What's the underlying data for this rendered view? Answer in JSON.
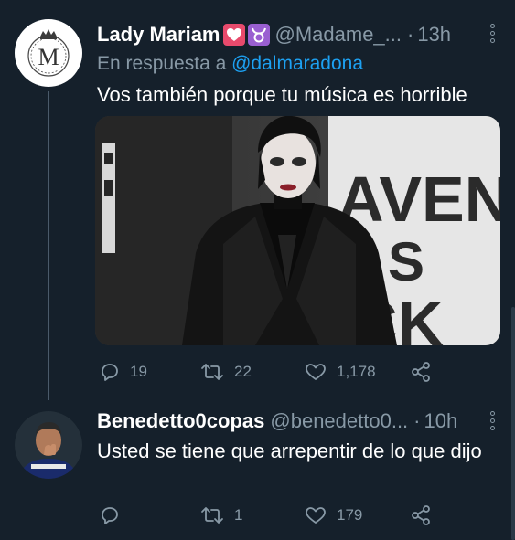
{
  "tweets": [
    {
      "name": "Lady Mariam",
      "handle": "@Madame_...",
      "time": "13h",
      "reply_prefix": "En respuesta a",
      "reply_mention": "@dalmaradona",
      "text": "Vos también porque tu música es horrible",
      "avatar_letter": "M",
      "emojis": [
        "heart-emoji",
        "taurus-emoji"
      ],
      "stats": {
        "replies": "19",
        "retweets": "22",
        "likes": "1,178"
      }
    },
    {
      "name": "Benedetto0copas",
      "handle": "@benedetto0...",
      "time": "10h",
      "text": "Usted se tiene que arrepentir de lo que dijo",
      "stats": {
        "replies": "",
        "retweets": "1",
        "likes": "179"
      }
    }
  ],
  "media": {
    "backdrop_text": "AVEN",
    "backdrop_text2": "S",
    "backdrop_text3": "CK"
  },
  "colors": {
    "background": "#15202b",
    "text_secondary": "#8899a6",
    "link": "#1da1f2"
  },
  "icons": [
    "reply-icon",
    "retweet-icon",
    "like-icon",
    "share-icon",
    "more-icon"
  ]
}
